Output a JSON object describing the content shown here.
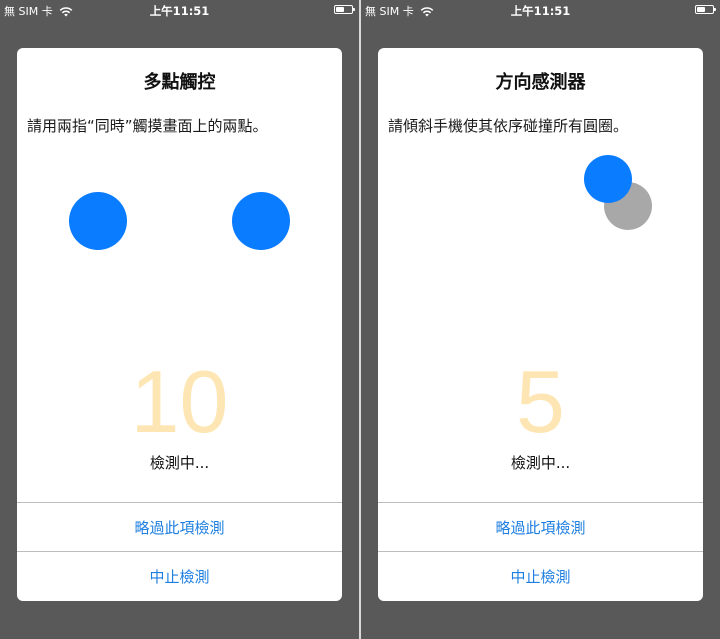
{
  "statusbar": {
    "carrier": "無 SIM 卡",
    "time": "上午11:51"
  },
  "screens": [
    {
      "title": "多點觸控",
      "instruction": "請用兩指“同時”觸摸畫面上的兩點。",
      "countdown": "10",
      "status": "檢測中...",
      "skip_label": "略過此項檢測",
      "stop_label": "中止檢測"
    },
    {
      "title": "方向感測器",
      "instruction": "請傾斜手機使其依序碰撞所有圓圈。",
      "countdown": "5",
      "status": "檢測中...",
      "skip_label": "略過此項檢測",
      "stop_label": "中止檢測"
    }
  ],
  "colors": {
    "accent": "#0a7cff",
    "target": "#a8a8a8",
    "countdown": "#fde6b3",
    "link": "#1f7fe0"
  }
}
